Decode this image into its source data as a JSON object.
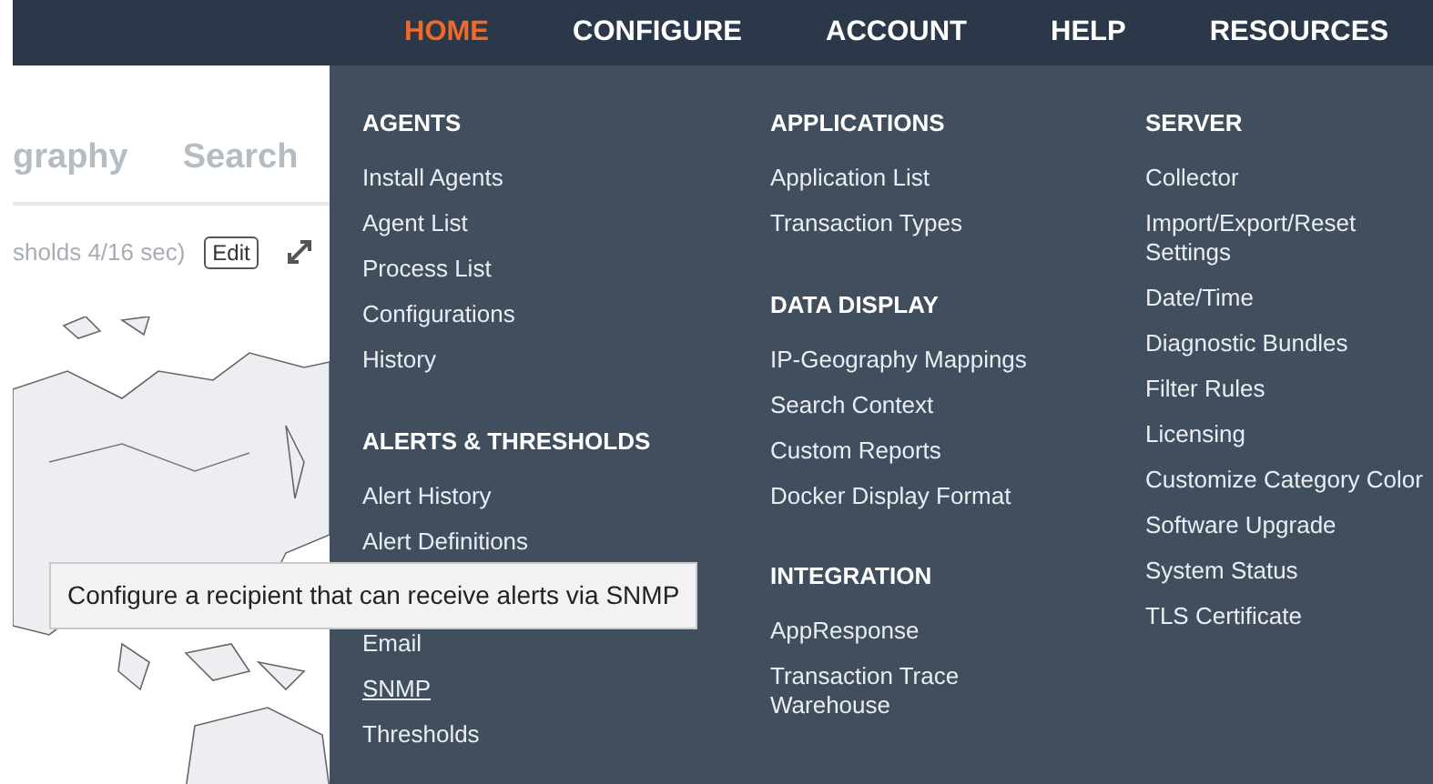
{
  "nav": [
    {
      "label": "HOME",
      "selected": true
    },
    {
      "label": "CONFIGURE",
      "selected": false
    },
    {
      "label": "ACCOUNT",
      "selected": false
    },
    {
      "label": "HELP",
      "selected": false
    },
    {
      "label": "RESOURCES",
      "selected": false
    }
  ],
  "background": {
    "tabs": [
      "graphy",
      "Search"
    ],
    "status": "sholds 4/16 sec)",
    "edit_button": "Edit",
    "map": {
      "kind": "picture"
    }
  },
  "menu": {
    "columns": [
      {
        "sections": [
          {
            "title": "AGENTS",
            "items": [
              {
                "label": "Install Agents",
                "hovered": false
              },
              {
                "label": "Agent List",
                "hovered": false
              },
              {
                "label": "Process List",
                "hovered": false
              },
              {
                "label": "Configurations",
                "hovered": false
              },
              {
                "label": "History",
                "hovered": false
              }
            ]
          },
          {
            "title": "ALERTS & THRESHOLDS",
            "items": [
              {
                "label": "Alert History",
                "hovered": false
              },
              {
                "label": "Alert Definitions",
                "hovered": false
              },
              {
                "label": "Email",
                "hovered": false,
                "covered_before": true
              },
              {
                "label": "SNMP",
                "hovered": true
              },
              {
                "label": "Thresholds",
                "hovered": false
              }
            ]
          }
        ]
      },
      {
        "sections": [
          {
            "title": "APPLICATIONS",
            "items": [
              {
                "label": "Application List",
                "hovered": false
              },
              {
                "label": "Transaction Types",
                "hovered": false
              }
            ]
          },
          {
            "title": "DATA DISPLAY",
            "items": [
              {
                "label": "IP-Geography Mappings",
                "hovered": false
              },
              {
                "label": "Search Context",
                "hovered": false
              },
              {
                "label": "Custom Reports",
                "hovered": false
              },
              {
                "label": "Docker Display Format",
                "hovered": false
              }
            ]
          },
          {
            "title": "INTEGRATION",
            "items": [
              {
                "label": "AppResponse",
                "hovered": false
              },
              {
                "label": "Transaction Trace Warehouse",
                "hovered": false
              }
            ]
          }
        ]
      },
      {
        "sections": [
          {
            "title": "SERVER",
            "items": [
              {
                "label": "Collector",
                "hovered": false
              },
              {
                "label": "Import/Export/Reset Settings",
                "hovered": false
              },
              {
                "label": "Date/Time",
                "hovered": false
              },
              {
                "label": "Diagnostic Bundles",
                "hovered": false
              },
              {
                "label": "Filter Rules",
                "hovered": false
              },
              {
                "label": "Licensing",
                "hovered": false
              },
              {
                "label": "Customize Category Color",
                "hovered": false
              },
              {
                "label": "Software Upgrade",
                "hovered": false
              },
              {
                "label": "System Status",
                "hovered": false
              },
              {
                "label": "TLS Certificate",
                "hovered": false
              }
            ]
          }
        ]
      }
    ]
  },
  "tooltip": "Configure a recipient that can receive alerts via SNMP"
}
